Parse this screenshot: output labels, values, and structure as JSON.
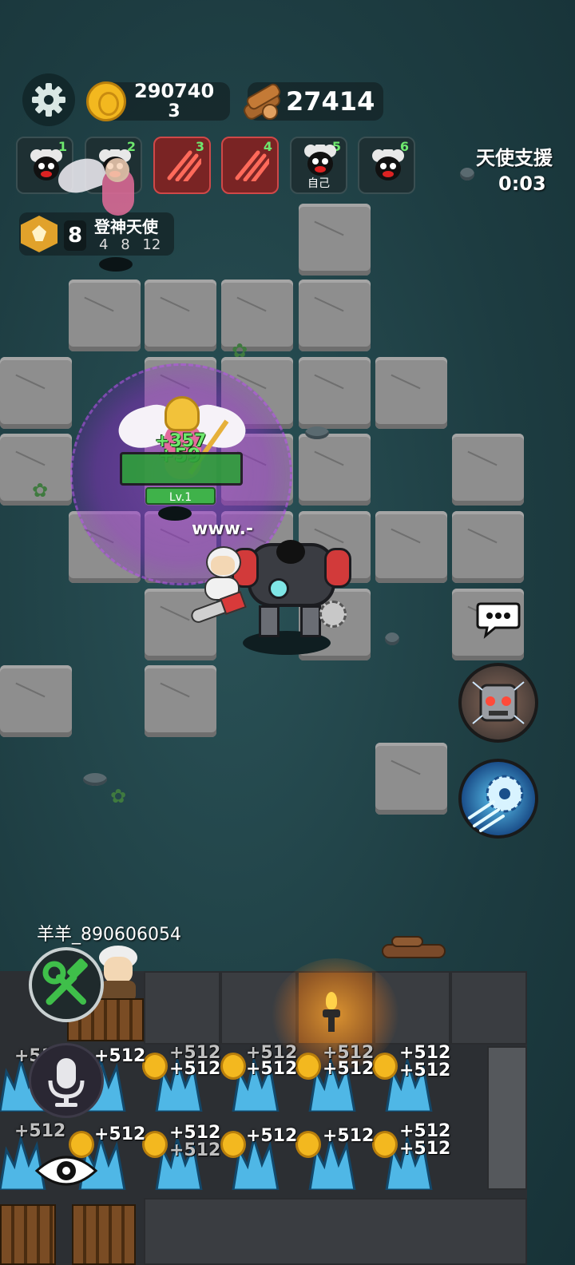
{
  "hud": {
    "gold_amount_line1": "290740",
    "gold_amount_line2": "3",
    "wood_amount": "27414",
    "settings_icon": "gear-icon",
    "gold_icon": "coin-icon",
    "wood_icon": "log-icon"
  },
  "players": [
    {
      "slot": "1",
      "sub": ""
    },
    {
      "slot": "2",
      "sub": ""
    },
    {
      "slot": "3",
      "sub": ""
    },
    {
      "slot": "4",
      "sub": ""
    },
    {
      "slot": "5",
      "sub": "自己"
    },
    {
      "slot": "6",
      "sub": ""
    }
  ],
  "support": {
    "title": "天使支援",
    "timer": "0:03"
  },
  "rank": {
    "level": "8",
    "name": "登神天使",
    "tiers": [
      "4",
      "8",
      "12"
    ]
  },
  "battle": {
    "angel_level": "Lv.1",
    "heal_value_a": "+357",
    "heal_value_b": "+59",
    "robot_name": "www.-"
  },
  "player_name": "羊羊_890606054",
  "harvest": {
    "plus_value": "+512"
  },
  "colors": {
    "accent_green": "#6ee86e",
    "slot_red": "#d04848",
    "gold": "#f3b81f",
    "crystal": "#4fb7e6"
  }
}
